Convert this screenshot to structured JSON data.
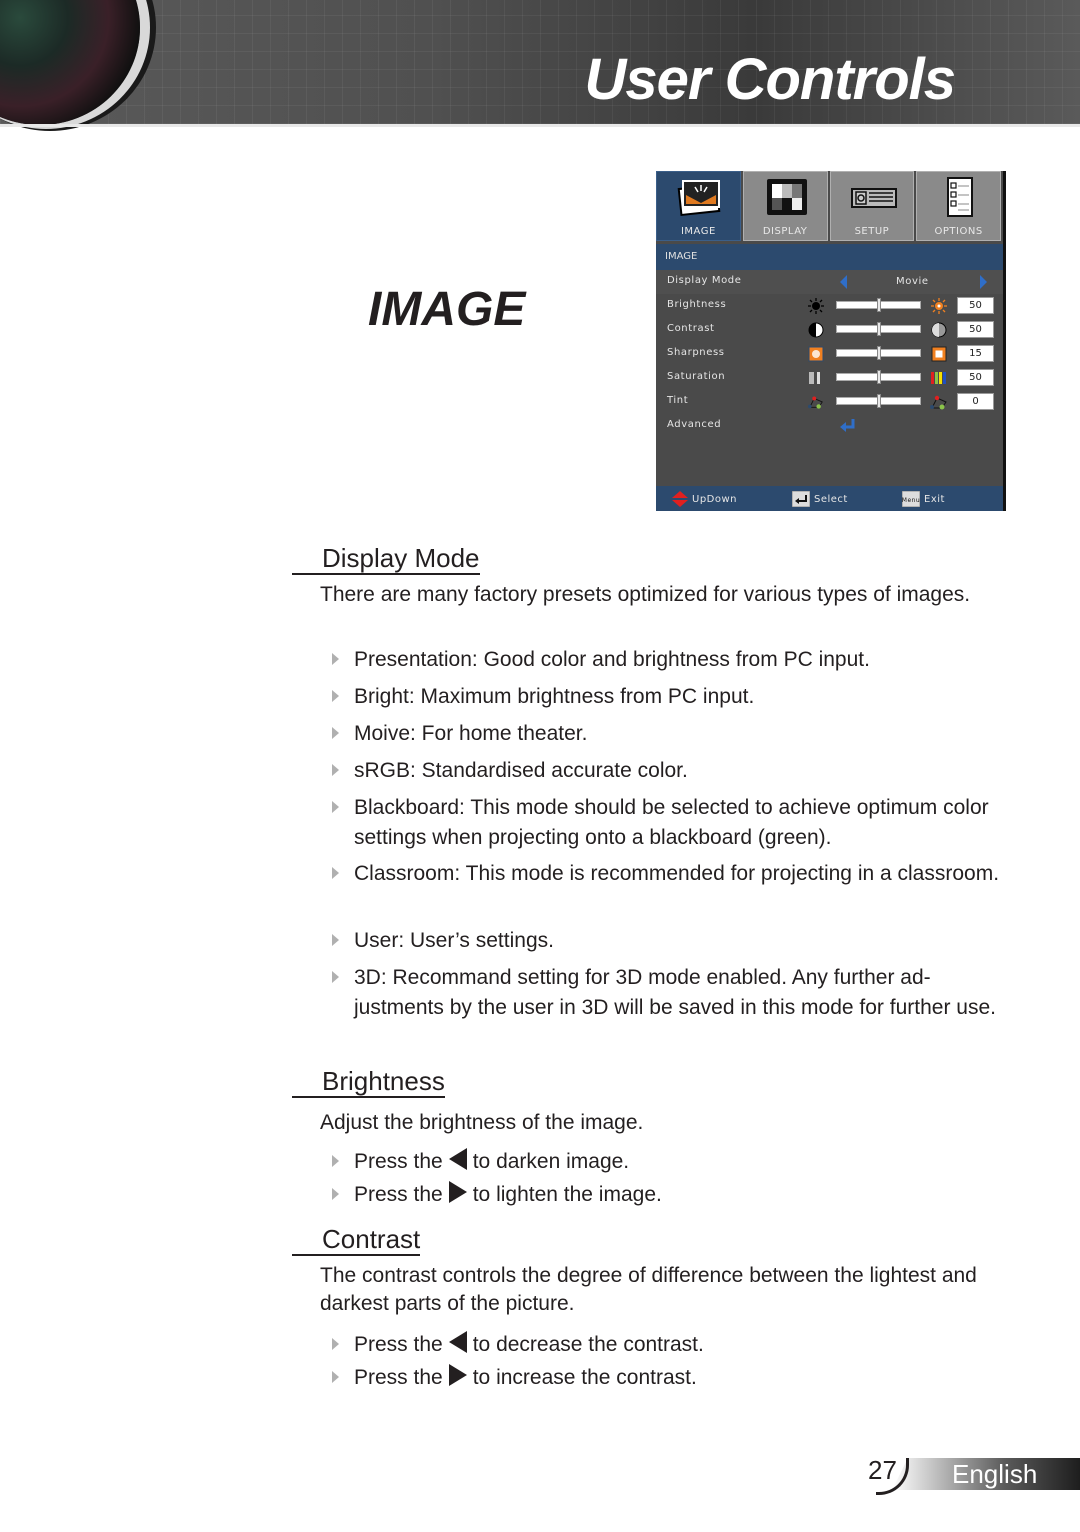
{
  "header": {
    "title": "User Controls"
  },
  "section_title": "IMAGE",
  "osd": {
    "tabs": [
      {
        "label": "IMAGE",
        "icon": "image-icon",
        "active": true
      },
      {
        "label": "DISPLAY",
        "icon": "display-icon",
        "active": false
      },
      {
        "label": "SETUP",
        "icon": "projector-icon",
        "active": false
      },
      {
        "label": "OPTIONS",
        "icon": "checklist-icon",
        "active": false
      }
    ],
    "subtitle": "IMAGE",
    "display_mode": {
      "label": "Display Mode",
      "value": "Movie"
    },
    "rows": [
      {
        "label": "Brightness",
        "value": "50",
        "slider_fraction": 0.5,
        "icon_left": "sun-dim-icon",
        "icon_right": "sun-bright-icon"
      },
      {
        "label": "Contrast",
        "value": "50",
        "slider_fraction": 0.5,
        "icon_left": "contrast-low-icon",
        "icon_right": "contrast-high-icon"
      },
      {
        "label": "Sharpness",
        "value": "15",
        "slider_fraction": 0.5,
        "icon_left": "sharpness-low-icon",
        "icon_right": "sharpness-high-icon"
      },
      {
        "label": "Saturation",
        "value": "50",
        "slider_fraction": 0.5,
        "icon_left": "saturation-low-icon",
        "icon_right": "saturation-high-icon"
      },
      {
        "label": "Tint",
        "value": "0",
        "slider_fraction": 0.5,
        "icon_left": "tint-low-icon",
        "icon_right": "tint-high-icon"
      }
    ],
    "advanced": {
      "label": "Advanced",
      "icon": "enter-icon"
    },
    "footer": {
      "updown": "UpDown",
      "select": "Select",
      "menu_key": "Menu",
      "exit": "Exit"
    },
    "colors": {
      "accent": "#2c4a6e",
      "panel": "#4a4a4a",
      "arrow": "#2f6ec8"
    }
  },
  "sections": {
    "display_mode": {
      "heading": "Display Mode",
      "intro": "There are many factory presets optimized for various types of images.",
      "bullets": [
        "Presentation: Good color and brightness from PC input.",
        "Bright: Maximum brightness from PC input.",
        "Moive: For home theater.",
        "sRGB: Standardised accurate color.",
        "Blackboard: This mode should be selected to achieve optimum color settings when projecting onto a blackboard (green).",
        "Classroom: This mode is recommended for projecting in a classroom.",
        "User: User’s settings.",
        "3D: Recommand setting for 3D mode enabled. Any further ad-justments by the user in 3D will be saved in this mode for further use."
      ]
    },
    "brightness": {
      "heading": "Brightness",
      "intro": "Adjust the brightness of the image.",
      "press_prefix": "Press the",
      "bullets": [
        {
          "key": "left",
          "suffix": "to darken image."
        },
        {
          "key": "right",
          "suffix": "to lighten the image."
        }
      ]
    },
    "contrast": {
      "heading": "Contrast",
      "intro": "The contrast controls the degree of difference between the lightest and darkest parts of the picture.",
      "press_prefix": "Press the",
      "bullets": [
        {
          "key": "left",
          "suffix": "to decrease the contrast."
        },
        {
          "key": "right",
          "suffix": "to increase the contrast."
        }
      ]
    }
  },
  "footer": {
    "page_number": "27",
    "language": "English"
  }
}
